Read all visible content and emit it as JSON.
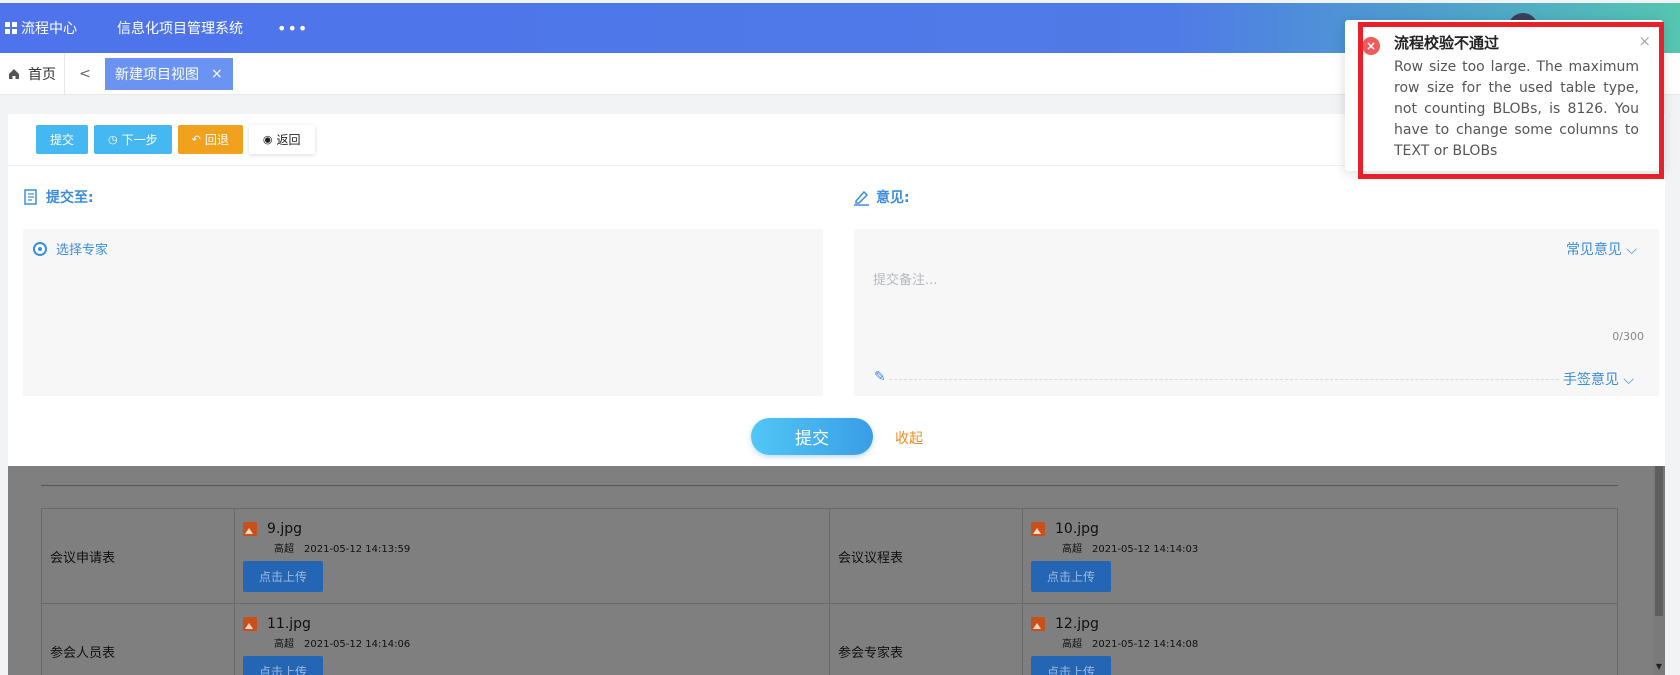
{
  "header": {
    "app_name": "流程中心",
    "system_name": "信息化项目管理系统",
    "more": "•••"
  },
  "tabs": {
    "home": "首页",
    "active_tab": "新建项目视图",
    "close": "×",
    "back": "<"
  },
  "toolbar": {
    "submit": "提交",
    "next": "下一步",
    "back": "回退",
    "return": "返回"
  },
  "form": {
    "submit_to_label": "提交至:",
    "opinion_label": "意见:",
    "select_expert": "选择专家",
    "common_opinion": "常见意见 ⌵",
    "placeholder": "提交备注...",
    "counter": "0/300",
    "handwritten_opinion": "手签意见 ⌵",
    "submit_button": "提交",
    "collapse": "收起"
  },
  "attachments": [
    {
      "left_label": "会议申请表",
      "left_file": "9.jpg",
      "left_user": "高超",
      "left_time": "2021-05-12 14:13:59",
      "right_label": "会议议程表",
      "right_file": "10.jpg",
      "right_user": "高超",
      "right_time": "2021-05-12 14:14:03"
    },
    {
      "left_label": "参会人员表",
      "left_file": "11.jpg",
      "left_user": "高超",
      "left_time": "2021-05-12 14:14:06",
      "right_label": "参会专家表",
      "right_file": "12.jpg",
      "right_user": "高超",
      "right_time": "2021-05-12 14:14:08"
    }
  ],
  "upload_label": "点击上传",
  "notification": {
    "title": "流程校验不通过",
    "message": "Row size too large. The maximum row size for the used table type, not counting BLOBs, is 8126. You have to change some columns to TEXT or BLOBs",
    "icon": "error-icon",
    "close": "×"
  },
  "colors": {
    "header_gradient_start": "#4e73ec",
    "header_gradient_end": "#55c6b0",
    "primary": "#45b8f2",
    "warning": "#f0a21e",
    "error": "#e8202a"
  }
}
